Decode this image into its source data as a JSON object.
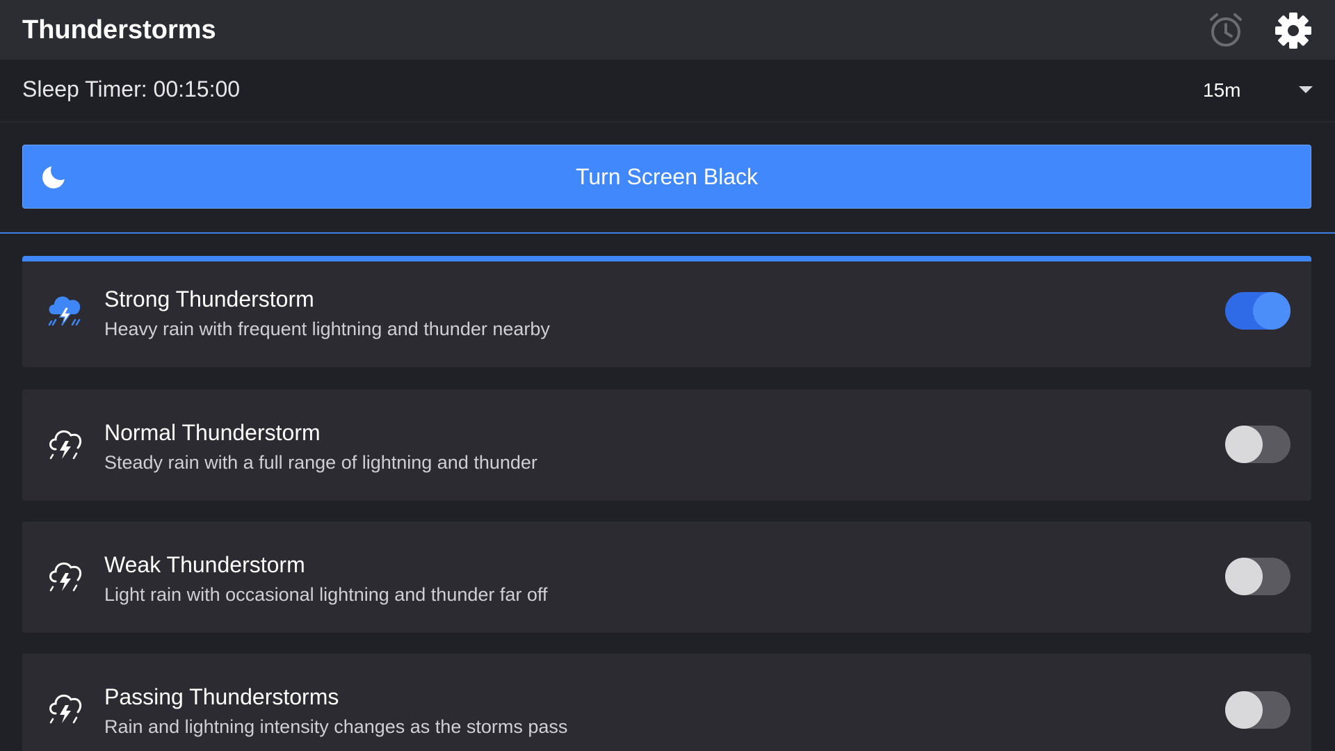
{
  "header": {
    "title": "Thunderstorms",
    "icons": [
      "alarm-clock-icon",
      "gear-icon"
    ]
  },
  "sleep_timer": {
    "label": "Sleep Timer: 00:15:00",
    "selected": "15m"
  },
  "black_button": {
    "label": "Turn Screen Black",
    "icon": "moon-icon"
  },
  "colors": {
    "accent": "#4088fb",
    "background": "#202027",
    "card": "#2b2b31"
  },
  "sounds": [
    {
      "name": "Strong Thunderstorm",
      "description": "Heavy rain with frequent lightning and thunder nearby",
      "enabled": true,
      "icon": "thunderstorm-icon"
    },
    {
      "name": "Normal Thunderstorm",
      "description": "Steady rain with a full range of lightning and thunder",
      "enabled": false,
      "icon": "thunderstorm-icon"
    },
    {
      "name": "Weak Thunderstorm",
      "description": "Light rain with occasional lightning and thunder far off",
      "enabled": false,
      "icon": "thunderstorm-icon"
    },
    {
      "name": "Passing Thunderstorms",
      "description": "Rain and lightning intensity changes as the storms pass",
      "enabled": false,
      "icon": "thunderstorm-icon"
    }
  ]
}
